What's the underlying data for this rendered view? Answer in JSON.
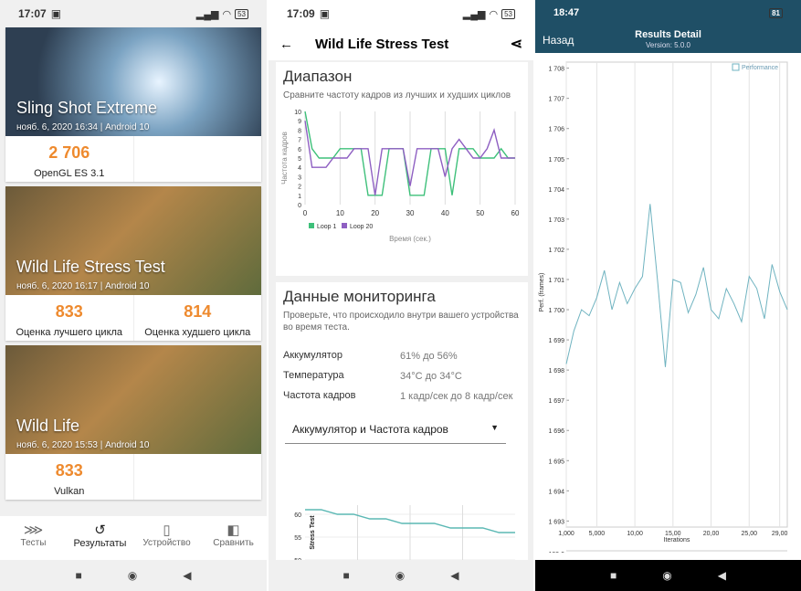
{
  "panel1": {
    "status": {
      "time": "17:07",
      "battery": "53"
    },
    "cards": [
      {
        "title": "Sling Shot Extreme",
        "subtitle": "нояб. 6, 2020 16:34 | Android 10",
        "scores": [
          {
            "value": "2 706",
            "label": "OpenGL ES 3.1"
          }
        ]
      },
      {
        "title": "Wild Life Stress Test",
        "subtitle": "нояб. 6, 2020 16:17 | Android 10",
        "scores": [
          {
            "value": "833",
            "label": "Оценка лучшего цикла"
          },
          {
            "value": "814",
            "label": "Оценка худшего цикла"
          }
        ]
      },
      {
        "title": "Wild Life",
        "subtitle": "нояб. 6, 2020 15:53 | Android 10",
        "scores": [
          {
            "value": "833",
            "label": "Vulkan"
          }
        ]
      }
    ],
    "nav": [
      {
        "label": "Тесты",
        "icon": "tests-icon"
      },
      {
        "label": "Результаты",
        "icon": "history-icon"
      },
      {
        "label": "Устройство",
        "icon": "device-icon"
      },
      {
        "label": "Сравнить",
        "icon": "compare-icon"
      }
    ]
  },
  "panel2": {
    "status": {
      "time": "17:09",
      "battery": "53"
    },
    "title": "Wild Life Stress Test",
    "range": {
      "title": "Диапазон",
      "desc": "Сравните частоту кадров из лучших и худших циклов",
      "ylabel": "Частота кадров",
      "xlabel": "Время (сек.)",
      "legend": [
        "Loop 1",
        "Loop 20"
      ],
      "colors": [
        "#3ec07a",
        "#8e5fc2"
      ]
    },
    "monitoring": {
      "title": "Данные мониторинга",
      "desc": "Проверьте, что происходило внутри вашего устройства во время теста.",
      "rows": [
        {
          "k": "Аккумулятор",
          "v": "61% до 56%"
        },
        {
          "k": "Температура",
          "v": "34°C до 34°C"
        },
        {
          "k": "Частота кадров",
          "v": "1 кадр/сек до 8 кадр/сек"
        }
      ],
      "dropdown": "Аккумулятор и Частота кадров",
      "mini_ylabel": "Stress Test"
    }
  },
  "panel3": {
    "status": {
      "time": "18:47",
      "battery": "81"
    },
    "back": "Назад",
    "title": "Results Detail",
    "version": "Version: 5.0.0",
    "legend": "Performance",
    "xlabel": "Iterations",
    "ylabel": "Perf. (frames)",
    "bottom_tick": "109,0"
  },
  "chart_data": [
    {
      "type": "line",
      "x": [
        0,
        2,
        4,
        6,
        8,
        10,
        12,
        14,
        16,
        18,
        20,
        22,
        24,
        26,
        28,
        30,
        32,
        34,
        36,
        38,
        40,
        42,
        44,
        46,
        48,
        50,
        52,
        54,
        56,
        58,
        60
      ],
      "series": [
        {
          "name": "Loop 1",
          "values": [
            10,
            6,
            5,
            5,
            5,
            6,
            6,
            6,
            6,
            1,
            1,
            1,
            6,
            6,
            6,
            1,
            1,
            1,
            6,
            6,
            6,
            1,
            6,
            6,
            6,
            5,
            5,
            5,
            6,
            5,
            5
          ]
        },
        {
          "name": "Loop 20",
          "values": [
            9,
            4,
            4,
            4,
            5,
            5,
            5,
            6,
            6,
            6,
            1,
            6,
            6,
            6,
            6,
            2,
            6,
            6,
            6,
            6,
            3,
            6,
            7,
            6,
            5,
            5,
            6,
            8,
            5,
            5,
            5
          ]
        }
      ],
      "xlim": [
        0,
        60
      ],
      "ylim": [
        0,
        10
      ],
      "xticks": [
        0,
        10,
        20,
        30,
        40,
        50,
        60
      ],
      "yticks": [
        0,
        1,
        2,
        3,
        4,
        5,
        6,
        7,
        8,
        9,
        10
      ],
      "xlabel": "Время (сек.)",
      "ylabel": "Частота кадров"
    },
    {
      "type": "line",
      "series": [
        {
          "values": [
            61,
            61,
            60,
            60,
            59,
            59,
            58,
            58,
            58,
            57,
            57,
            57,
            56,
            56
          ]
        }
      ],
      "ylim": [
        50,
        62
      ],
      "yticks": [
        50,
        55,
        60
      ]
    },
    {
      "type": "line",
      "x": [
        1,
        2,
        3,
        4,
        5,
        6,
        7,
        8,
        9,
        10,
        11,
        12,
        13,
        14,
        15,
        16,
        17,
        18,
        19,
        20,
        21,
        22,
        23,
        24,
        25,
        26,
        27,
        28,
        29,
        30
      ],
      "series": [
        {
          "name": "Performance",
          "values": [
            1698.2,
            1699.3,
            1700.0,
            1699.8,
            1700.4,
            1701.3,
            1700.0,
            1700.9,
            1700.2,
            1700.7,
            1701.1,
            1703.5,
            1700.9,
            1698.1,
            1701.0,
            1700.9,
            1699.9,
            1700.5,
            1701.4,
            1700.0,
            1699.7,
            1700.7,
            1700.2,
            1699.6,
            1701.1,
            1700.7,
            1699.7,
            1701.5,
            1700.6,
            1700.0
          ]
        }
      ],
      "yticks": [
        "1 693",
        "1 694",
        "1 695",
        "1 696",
        "1 697",
        "1 698",
        "1 699",
        "1 700",
        "1 701",
        "1 702",
        "1 703",
        "1 704",
        "1 705",
        "1 706",
        "1 707",
        "1 708"
      ],
      "xticks": [
        "1,000",
        "5,000",
        "10,00",
        "15,00",
        "20,00",
        "25,00",
        "29,00"
      ],
      "ylim": [
        1692.8,
        1708.2
      ],
      "xlabel": "Iterations",
      "ylabel": "Perf. (frames)"
    }
  ]
}
